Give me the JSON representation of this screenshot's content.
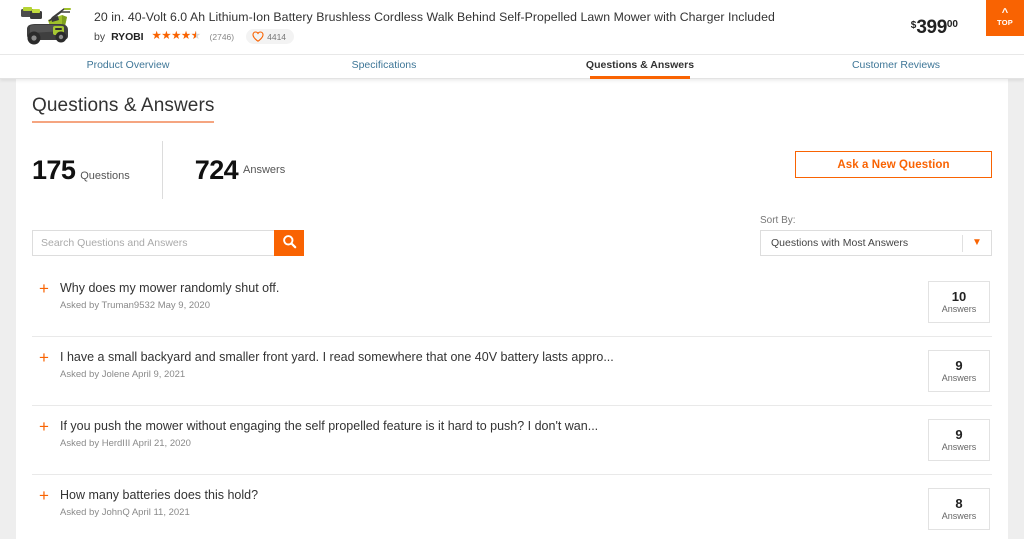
{
  "product": {
    "title": "20 in. 40-Volt 6.0 Ah Lithium-Ion Battery Brushless Cordless Walk Behind Self-Propelled Lawn Mower with Charger Included",
    "by_label": "by",
    "brand": "RYOBI",
    "rating": 4.5,
    "review_count": "(2746)",
    "favorite_count": "4414",
    "price_currency": "$",
    "price_dollars": "399",
    "price_cents": "00",
    "top_button_label": "TOP"
  },
  "tabs": [
    {
      "label": "Product Overview",
      "active": false
    },
    {
      "label": "Specifications",
      "active": false
    },
    {
      "label": "Questions & Answers",
      "active": true
    },
    {
      "label": "Customer Reviews",
      "active": false
    }
  ],
  "qa": {
    "heading": "Questions & Answers",
    "stats": [
      {
        "number": "175",
        "label": "Questions"
      },
      {
        "number": "724",
        "label": "Answers"
      }
    ],
    "ask_button_label": "Ask a New Question",
    "search_placeholder": "Search Questions and Answers",
    "search_value": "",
    "sort_label": "Sort By:",
    "sort_value": "Questions with Most Answers",
    "sort_options": [
      "Questions with Most Answers"
    ],
    "answers_word": "Answers",
    "questions": [
      {
        "title": "Why does my mower randomly shut off.",
        "asked": "Asked by Truman9532 May 9, 2020",
        "answers": "10"
      },
      {
        "title": "I have a small backyard and smaller front yard. I read somewhere that one 40V battery lasts appro...",
        "asked": "Asked by Jolene April 9, 2021",
        "answers": "9"
      },
      {
        "title": "If you push the mower without engaging the self propelled feature is it hard to push? I don't wan...",
        "asked": "Asked by HerdIII April 21, 2020",
        "answers": "9"
      },
      {
        "title": "How many batteries does this hold?",
        "asked": "Asked by JohnQ April 11, 2021",
        "answers": "8"
      }
    ]
  },
  "colors": {
    "accent": "#f96302",
    "link": "#3e7697",
    "text": "#333333",
    "muted": "#8a8a8a"
  }
}
